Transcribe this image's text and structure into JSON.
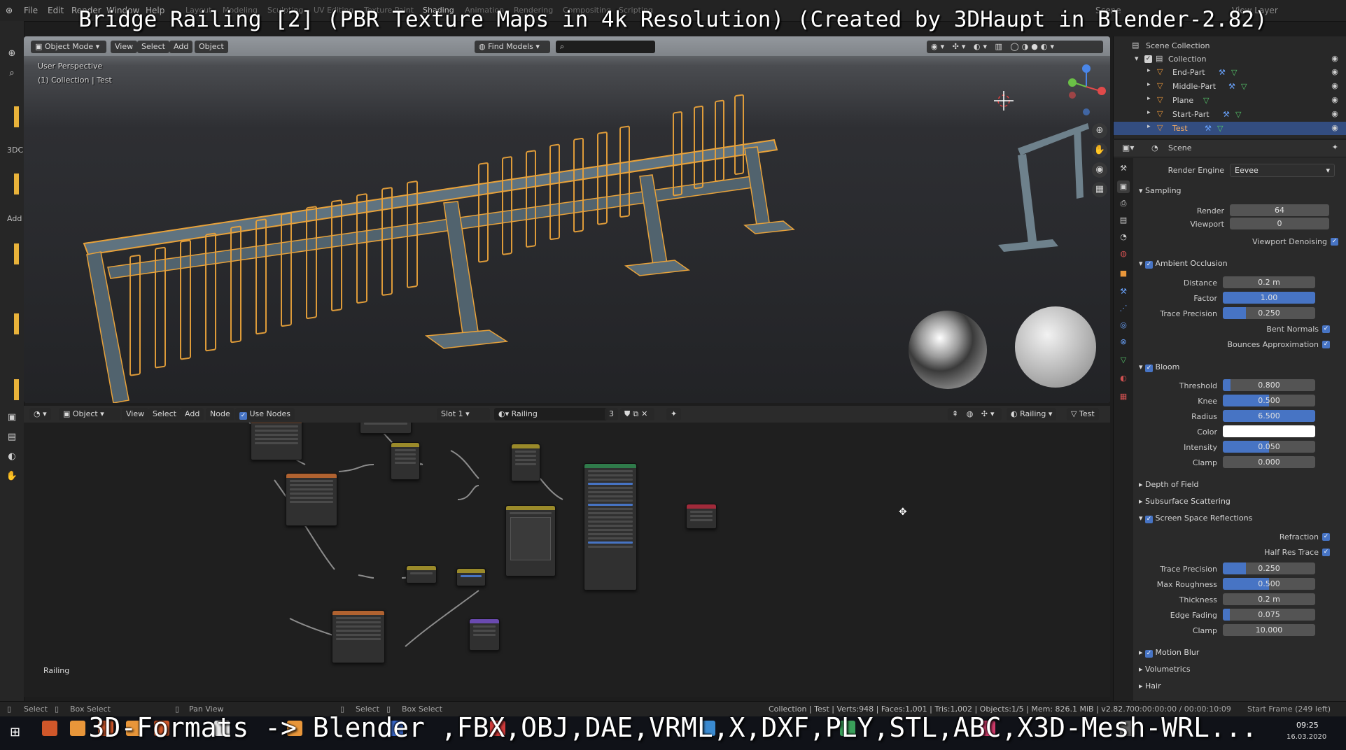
{
  "overlay_title": "Bridge Railing [2] (PBR Texture Maps in 4k Resolution) (Created by 3DHaupt in Blender-2.82)",
  "overlay_formats": "3D-Formats -> Blender ,FBX,OBJ,DAE,VRML,X,DXF,PLY,STL,ABC,X3D-Mesh-WRL...",
  "topbar": {
    "menus": [
      "File",
      "Edit",
      "Render",
      "Window",
      "Help"
    ],
    "workspaces": [
      "Layout",
      "Modeling",
      "Sculpting",
      "UV Editing",
      "Texture Paint",
      "Shading",
      "Animation",
      "Rendering",
      "Compositing",
      "Scripting"
    ],
    "scene": "Scene",
    "view_layer": "View Layer"
  },
  "left_side": {
    "label_3d": "3DC",
    "label_add": "Add"
  },
  "viewport": {
    "mode": "Object Mode",
    "menus": [
      "View",
      "Select",
      "Add",
      "Object"
    ],
    "find_models": "Find Models",
    "perspective": "User Perspective",
    "collection_info": "(1) Collection | Test"
  },
  "node_editor": {
    "editor_type": "Object",
    "menus": [
      "View",
      "Select",
      "Add",
      "Node"
    ],
    "use_nodes": "Use Nodes",
    "slot": "Slot 1",
    "material": "Railing",
    "users": "3",
    "right_material": "Railing",
    "right_object": "Test",
    "frame_label": "Railing"
  },
  "outliner": {
    "root": "Scene Collection",
    "collection": "Collection",
    "items": [
      {
        "label": "End-Part",
        "selected": false
      },
      {
        "label": "Middle-Part",
        "selected": false
      },
      {
        "label": "Plane",
        "selected": false
      },
      {
        "label": "Start-Part",
        "selected": false
      },
      {
        "label": "Test",
        "selected": true
      }
    ]
  },
  "properties": {
    "context": "Scene",
    "render_engine_label": "Render Engine",
    "render_engine": "Eevee",
    "sampling": {
      "title": "Sampling",
      "render_label": "Render",
      "render": "64",
      "viewport_label": "Viewport",
      "viewport": "0",
      "denoise_label": "Viewport Denoising"
    },
    "ao": {
      "title": "Ambient Occlusion",
      "distance_label": "Distance",
      "distance": "0.2 m",
      "factor_label": "Factor",
      "factor": "1.00",
      "factor_fraction": 1.0,
      "trace_label": "Trace Precision",
      "trace": "0.250",
      "trace_fraction": 0.25,
      "bent_label": "Bent Normals",
      "bounces_label": "Bounces Approximation"
    },
    "bloom": {
      "title": "Bloom",
      "threshold_label": "Threshold",
      "threshold": "0.800",
      "threshold_fraction": 0.08,
      "knee_label": "Knee",
      "knee": "0.500",
      "knee_fraction": 0.5,
      "radius_label": "Radius",
      "radius": "6.500",
      "radius_fraction": 1.0,
      "color_label": "Color",
      "color": "#ffffff",
      "intensity_label": "Intensity",
      "intensity": "0.050",
      "intensity_fraction": 0.5,
      "clamp_label": "Clamp",
      "clamp": "0.000"
    },
    "dof": "Depth of Field",
    "sss": "Subsurface Scattering",
    "ssr": {
      "title": "Screen Space Reflections",
      "refraction_label": "Refraction",
      "half_res_label": "Half Res Trace",
      "trace_label": "Trace Precision",
      "trace": "0.250",
      "trace_fraction": 0.25,
      "rough_label": "Max Roughness",
      "rough": "0.500",
      "rough_fraction": 0.5,
      "thick_label": "Thickness",
      "thick": "0.2 m",
      "edge_label": "Edge Fading",
      "edge": "0.075",
      "edge_fraction": 0.075,
      "clamp_label": "Clamp",
      "clamp": "10.000"
    },
    "motion_blur": "Motion Blur",
    "volumetrics": "Volumetrics",
    "hair": "Hair"
  },
  "statusbar": {
    "select": "Select",
    "box_select": "Box Select",
    "pan_view": "Pan View",
    "select2": "Select",
    "box_select2": "Box Select",
    "stats": "Collection | Test | Verts:948 | Faces:1,001 | Tris:1,002 | Objects:1/5 | Mem: 826.1 MiB | v2.82.7",
    "time": "00:00:00:00 / 00:00:10:09",
    "start_frame": "Start Frame (249 left)"
  },
  "taskbar": {
    "clock": "09:25",
    "date": "16.03.2020"
  },
  "colors": {
    "accent": "#4774c4",
    "selection_orange": "#e8a23a",
    "outliner_select": "#334d80"
  }
}
